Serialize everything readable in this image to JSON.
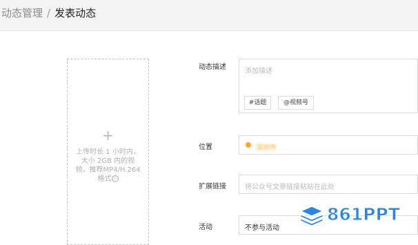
{
  "breadcrumb": {
    "parent": "动态管理",
    "separator": "/",
    "current": "发表动态"
  },
  "upload": {
    "plus": "+",
    "hint": "上传时长 1 小时内，大小 2GB 内的视频，推荐MP4/H.264格式",
    "info_icon": "ⓘ"
  },
  "form": {
    "description": {
      "label": "动态描述",
      "placeholder": "添加描述",
      "tag_topic": "#话题",
      "tag_channel": "@视频号"
    },
    "location": {
      "label": "位置",
      "value": "深圳市",
      "icon": "location-pin-icon",
      "value_color": "#f5a623"
    },
    "link": {
      "label": "扩展链接",
      "placeholder": "将公众号文章链接粘贴在此处"
    },
    "activity": {
      "label": "活动",
      "value": "不参与活动"
    }
  },
  "watermark": {
    "text": "861PPT",
    "color": "#2a86e0"
  }
}
